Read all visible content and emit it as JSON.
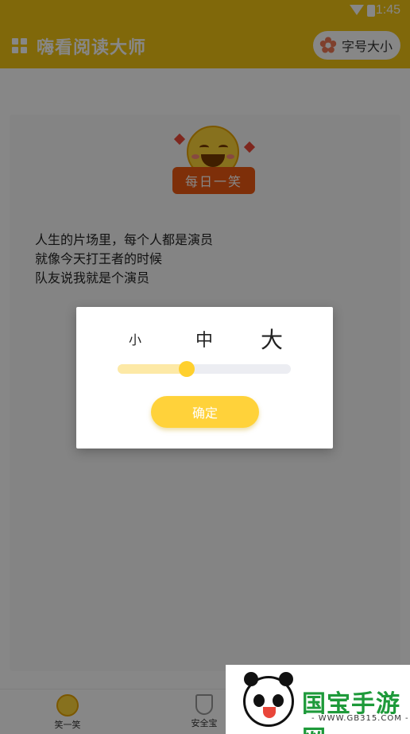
{
  "status_bar": {
    "time": "1:45"
  },
  "app_bar": {
    "title": "嗨看阅读大师",
    "font_size_button": "字号大小"
  },
  "joke_card": {
    "badge": "每日一笑",
    "lines": [
      "人生的片场里，每个人都是演员",
      "就像今天打王者的时候",
      "队友说我就是个演员"
    ]
  },
  "dialog": {
    "sizes": [
      "小",
      "中",
      "大"
    ],
    "slider_position": 0.4,
    "confirm_label": "确定"
  },
  "bottom_nav": {
    "items": [
      {
        "label": "笑一笑",
        "icon": "smile-icon"
      },
      {
        "label": "安全宝",
        "icon": "shield-icon"
      }
    ]
  },
  "watermark": {
    "title": "国宝手游网",
    "url": "- WWW.GB315.COM -"
  },
  "colors": {
    "primary": "#f2c413",
    "badge": "#ef5a12",
    "confirm": "#ffd23a",
    "slider_fill": "#fde9a6"
  }
}
